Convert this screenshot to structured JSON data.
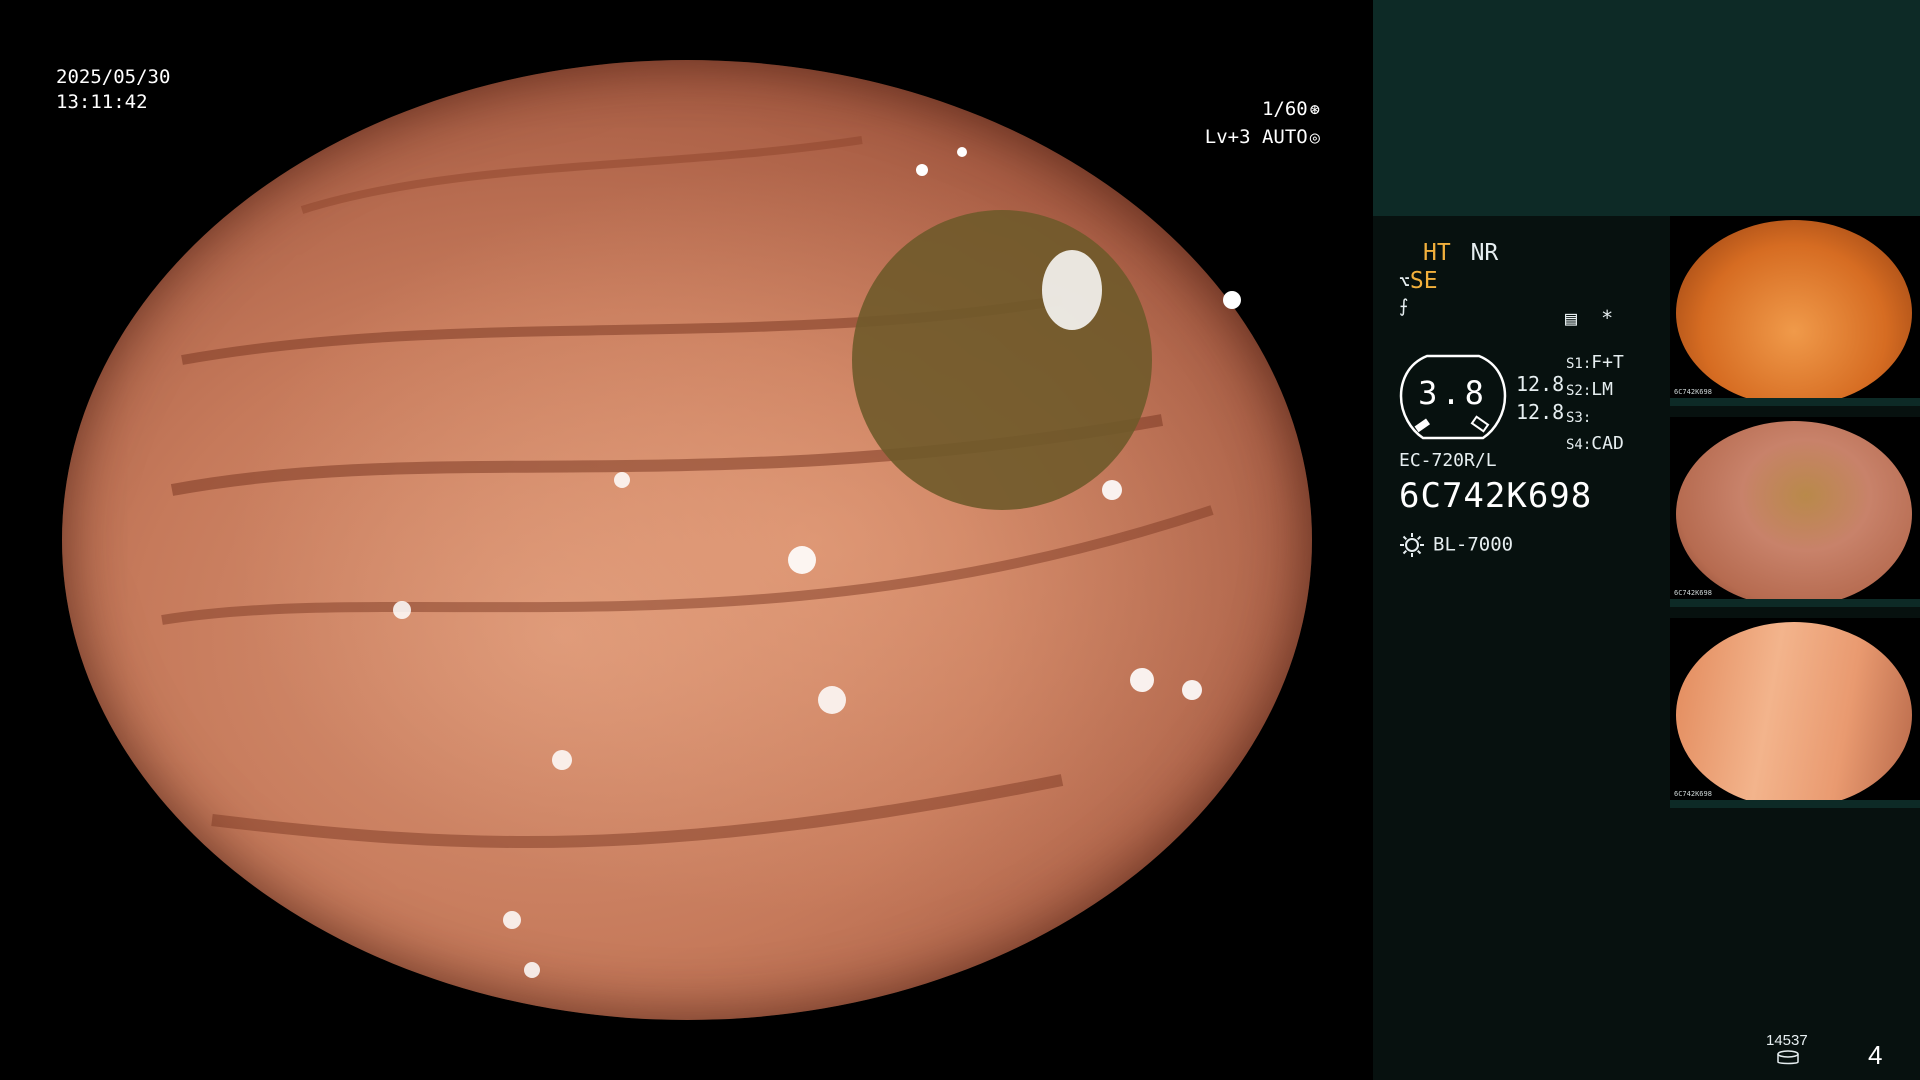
{
  "overlay": {
    "date": "2025/05/30",
    "time": "13:11:42",
    "shutter": "1/60",
    "level": "Lv+3 AUTO"
  },
  "panel": {
    "ht": "HT",
    "nr": "NR",
    "se": "SE",
    "gauge_value": "3.8",
    "value_a": "12.8",
    "value_b": "12.8",
    "star": "*",
    "s_list": [
      {
        "key": "S1:",
        "val": "F+T"
      },
      {
        "key": "S2:",
        "val": "LM"
      },
      {
        "key": "S3:",
        "val": ""
      },
      {
        "key": "S4:",
        "val": "CAD"
      }
    ],
    "scope_model": "EC-720R/L",
    "scope_serial": "6C742K698",
    "light_source": "BL-7000"
  },
  "thumbnails": [
    {
      "caption_serial": "6C742K698"
    },
    {
      "caption_serial": "6C742K698"
    },
    {
      "caption_serial": "6C742K698"
    }
  ],
  "footer": {
    "counter": "14537",
    "page": "4"
  },
  "colors": {
    "accent_orange": "#f2b03c",
    "panel_band": "#0d2a26",
    "panel_bg": "#07110f"
  }
}
